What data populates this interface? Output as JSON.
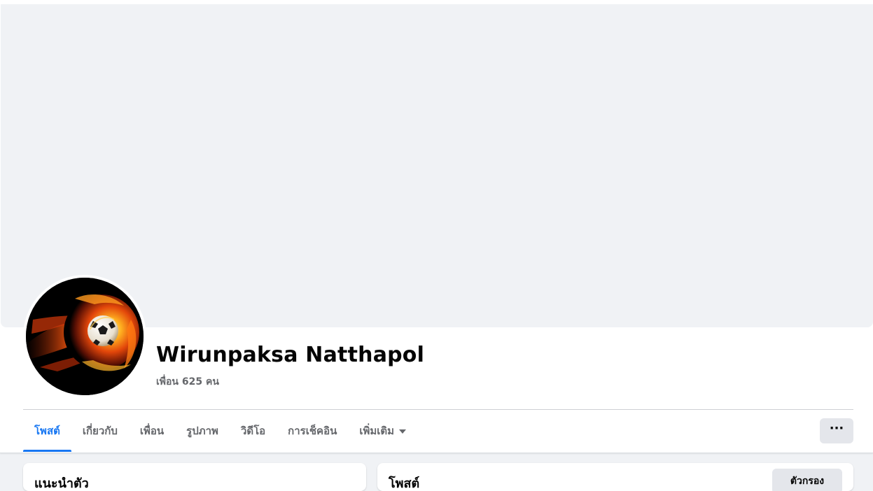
{
  "profile": {
    "name": "Wirunpaksa Natthapol",
    "friends": "เพื่อน 625 คน",
    "avatar_icon": "flaming-soccer-ball-icon"
  },
  "tabs": [
    {
      "label": "โพสต์",
      "active": true
    },
    {
      "label": "เกี่ยวกับ",
      "active": false
    },
    {
      "label": "เพื่อน",
      "active": false
    },
    {
      "label": "รูปภาพ",
      "active": false
    },
    {
      "label": "วิดีโอ",
      "active": false
    },
    {
      "label": "การเช็คอิน",
      "active": false
    },
    {
      "label": "เพิ่มเติม",
      "active": false
    }
  ],
  "actions": {
    "more_label": "···",
    "more_icon": "ellipsis-icon"
  },
  "cards": {
    "intro_title": "แนะนำตัว",
    "posts_title": "โพสต์",
    "filter_label": "ตัวกรอง"
  },
  "colors": {
    "accent": "#1877f2",
    "text_primary": "#050505",
    "text_secondary": "#65676b",
    "background": "#f0f2f5"
  }
}
